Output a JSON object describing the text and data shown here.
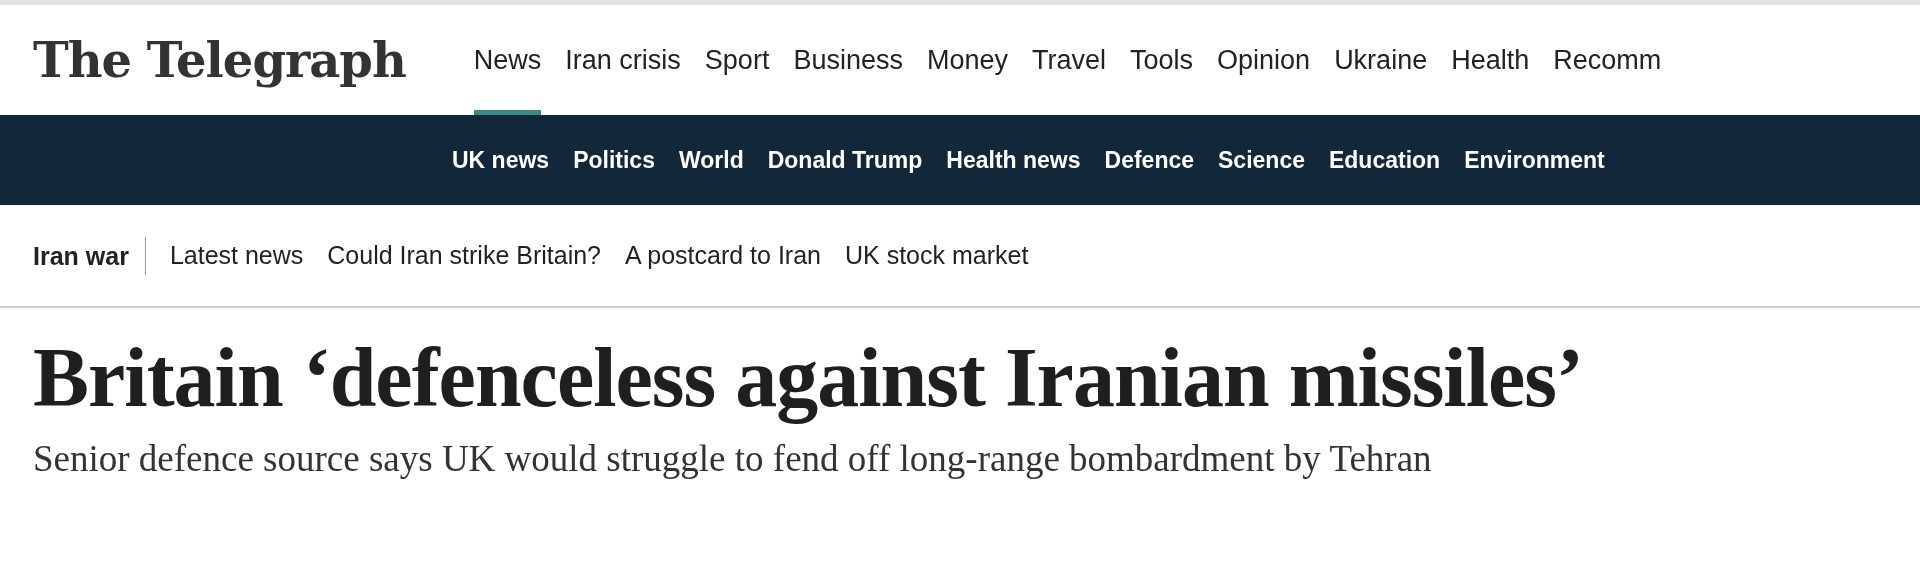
{
  "masthead": {
    "logo": "The Telegraph"
  },
  "main_nav": [
    {
      "label": "News",
      "selected": true
    },
    {
      "label": "Iran crisis",
      "selected": false
    },
    {
      "label": "Sport",
      "selected": false
    },
    {
      "label": "Business",
      "selected": false
    },
    {
      "label": "Money",
      "selected": false
    },
    {
      "label": "Travel",
      "selected": false
    },
    {
      "label": "Tools",
      "selected": false
    },
    {
      "label": "Opinion",
      "selected": false
    },
    {
      "label": "Ukraine",
      "selected": false
    },
    {
      "label": "Health",
      "selected": false
    },
    {
      "label": "Recomm",
      "selected": false
    }
  ],
  "section_nav": [
    "UK news",
    "Politics",
    "World",
    "Donald Trump",
    "Health news",
    "Defence",
    "Science",
    "Education",
    "Environment"
  ],
  "topic_bar": {
    "title": "Iran war",
    "links": [
      "Latest news",
      "Could Iran strike Britain?",
      "A postcard to Iran",
      "UK stock market"
    ]
  },
  "article": {
    "headline": "Britain ‘defenceless against Iranian missiles’",
    "standfirst": "Senior defence source says UK would struggle to fend off long-range bombardment by Tehran"
  }
}
